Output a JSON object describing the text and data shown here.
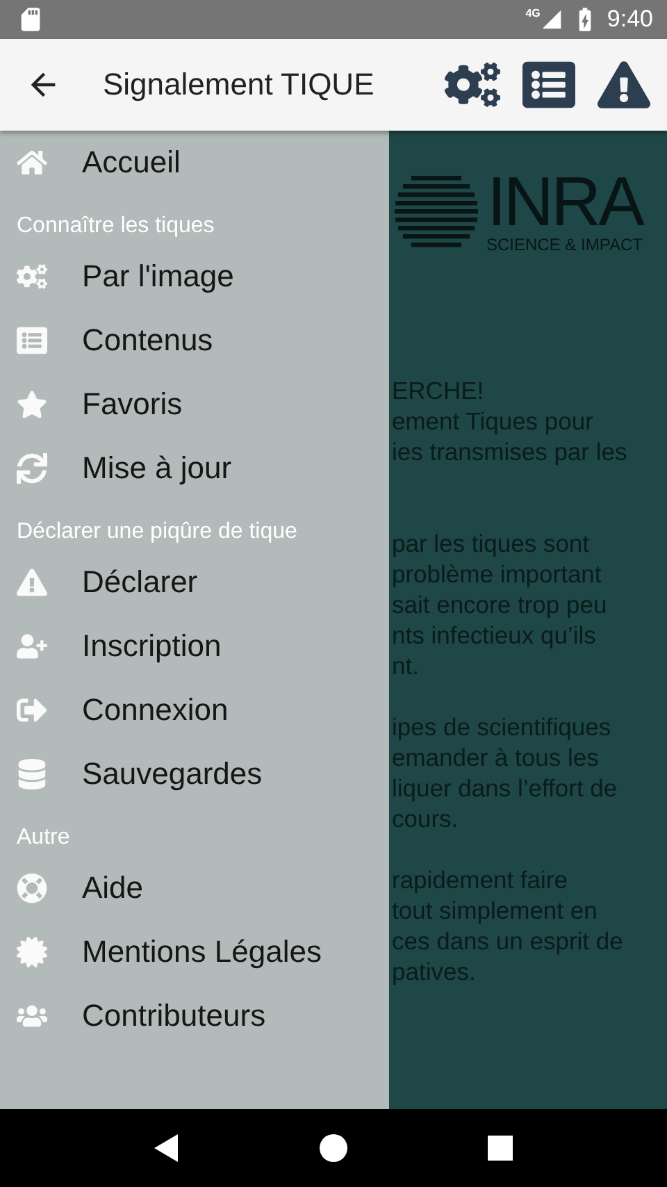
{
  "status_bar": {
    "network": "4G",
    "time": "9:40"
  },
  "app_bar": {
    "title": "Signalement TIQUE"
  },
  "page": {
    "logo_name": "INRA",
    "logo_tagline": "SCIENCE & IMPACT",
    "heading": "ERCHE!",
    "paragraphs": [
      [
        "ement Tiques pour",
        "ies transmises par les"
      ],
      [
        "par les tiques sont",
        "problème important",
        "sait encore trop peu",
        "nts infectieux qu’ils",
        "nt."
      ],
      [
        "ipes de scientifiques",
        "emander à tous les",
        "liquer dans l’effort de",
        "cours."
      ],
      [
        "rapidement faire",
        "tout simplement en",
        "ces dans un esprit de",
        "patives."
      ]
    ]
  },
  "drawer": {
    "sections": [
      {
        "items": [
          "Accueil"
        ]
      },
      {
        "header": "Connaître les tiques",
        "items": [
          "Par l'image",
          "Contenus",
          "Favoris",
          "Mise à jour"
        ]
      },
      {
        "header": "Déclarer une piqûre de tique",
        "items": [
          "Déclarer",
          "Inscription",
          "Connexion",
          "Sauvegardes"
        ]
      },
      {
        "header": "Autre",
        "items": [
          "Aide",
          "Mentions Légales",
          "Contributeurs"
        ]
      }
    ]
  }
}
